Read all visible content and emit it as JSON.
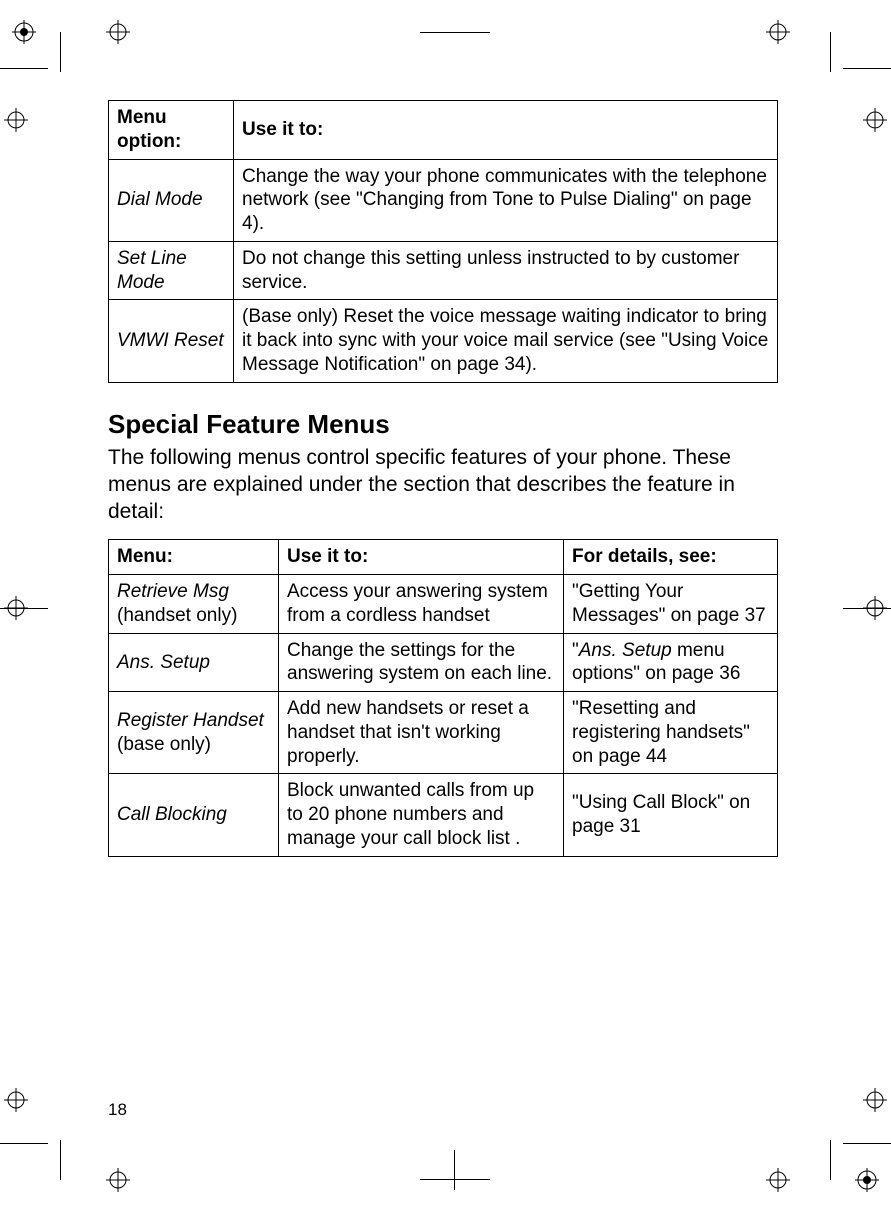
{
  "page_number": "18",
  "table1": {
    "headers": {
      "col1": "Menu option:",
      "col2": "Use it to:"
    },
    "rows": [
      {
        "option": "Dial Mode",
        "desc": "Change the way your phone communicates with the telephone network (see \"Changing from Tone to Pulse Dialing\" on page 4)."
      },
      {
        "option": "Set Line Mode",
        "desc": "Do not change this setting unless instructed to by customer service."
      },
      {
        "option": "VMWI Reset",
        "desc": "(Base only) Reset the voice message waiting indicator to bring it back into sync with your voice mail service (see \"Using Voice Message Notification\" on page 34)."
      }
    ]
  },
  "section_heading": "Special Feature Menus",
  "section_intro": "The following menus control specific features of your phone. These menus are explained under the section that describes the feature in detail:",
  "table2": {
    "headers": {
      "col1": "Menu:",
      "col2": "Use it to:",
      "col3": "For details, see:"
    },
    "rows": [
      {
        "option": "Retrieve Msg",
        "option_note": "(handset only)",
        "desc": "Access your answering system from a cordless handset",
        "details_pre": "\"Getting Your Messages\" on page 37",
        "details_italic": "",
        "details_post": ""
      },
      {
        "option": "Ans. Setup",
        "option_note": "",
        "desc": "Change the settings for the answering system on each line.",
        "details_pre": "\"",
        "details_italic": "Ans. Setup",
        "details_post": " menu options\" on page 36"
      },
      {
        "option": "Register Handset",
        "option_note": "(base only)",
        "desc": "Add new handsets or reset a handset that isn't working properly.",
        "details_pre": "\"Resetting and registering handsets\" on page 44",
        "details_italic": "",
        "details_post": ""
      },
      {
        "option": "Call Blocking",
        "option_note": "",
        "desc": "Block unwanted calls from up to 20 phone numbers and manage your call block list .",
        "details_pre": "\"Using Call Block\" on page 31",
        "details_italic": "",
        "details_post": ""
      }
    ]
  }
}
